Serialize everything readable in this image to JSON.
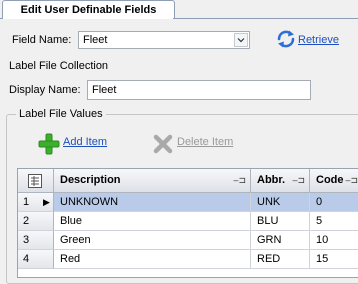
{
  "tab": {
    "label": "Edit User Definable Fields"
  },
  "field_name": {
    "label": "Field Name:",
    "value": "Fleet"
  },
  "retrieve": {
    "label": "Retrieve"
  },
  "label_file_collection": {
    "label": "Label File Collection"
  },
  "display_name": {
    "label": "Display Name:",
    "value": "Fleet"
  },
  "label_file_values": {
    "label": "Label File Values"
  },
  "toolbar": {
    "add_label": "Add Item",
    "delete_label": "Delete Item"
  },
  "grid": {
    "columns": [
      "Description",
      "Abbr.",
      "Code"
    ],
    "rows": [
      {
        "num": "1",
        "description": "UNKNOWN",
        "abbr": "UNK",
        "code": "0",
        "selected": true
      },
      {
        "num": "2",
        "description": "Blue",
        "abbr": "BLU",
        "code": "5"
      },
      {
        "num": "3",
        "description": "Green",
        "abbr": "GRN",
        "code": "10"
      },
      {
        "num": "4",
        "description": "Red",
        "abbr": "RED",
        "code": "15"
      }
    ]
  },
  "colors": {
    "link": "#1f4fbf",
    "selection": "#b9cbe8",
    "add_icon": "#3cb02c"
  }
}
